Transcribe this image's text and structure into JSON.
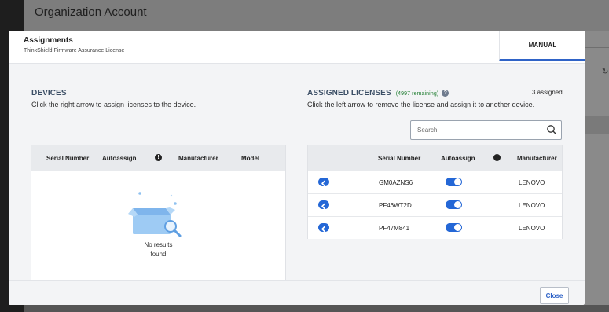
{
  "page": {
    "title": "Organization Account"
  },
  "modal": {
    "title": "Assignments",
    "subtitle": "ThinkShield Firmware Assurance License",
    "tab_manual": "MANUAL",
    "close_label": "Close"
  },
  "devices": {
    "title": "DEVICES",
    "description": "Click the right arrow to assign licenses to the device.",
    "columns": [
      "Serial Number",
      "Autoassign",
      "Manufacturer",
      "Model"
    ],
    "empty_line1": "No results",
    "empty_line2": "found"
  },
  "licenses": {
    "title": "ASSIGNED LICENSES",
    "remaining": "(4997 remaining)",
    "assigned_count": "3 assigned",
    "description": "Click the left arrow to remove the license and assign it to another device.",
    "search_placeholder": "Search",
    "columns": [
      "Serial Number",
      "Autoassign",
      "Manufacturer"
    ],
    "rows": [
      {
        "serial": "GM0AZNS6",
        "autoassign": true,
        "manufacturer": "LENOVO"
      },
      {
        "serial": "PF46WT2D",
        "autoassign": true,
        "manufacturer": "LENOVO"
      },
      {
        "serial": "PF47M841",
        "autoassign": true,
        "manufacturer": "LENOVO"
      }
    ]
  },
  "colors": {
    "accent": "#2467d6",
    "remaining": "#1d7c2f"
  }
}
